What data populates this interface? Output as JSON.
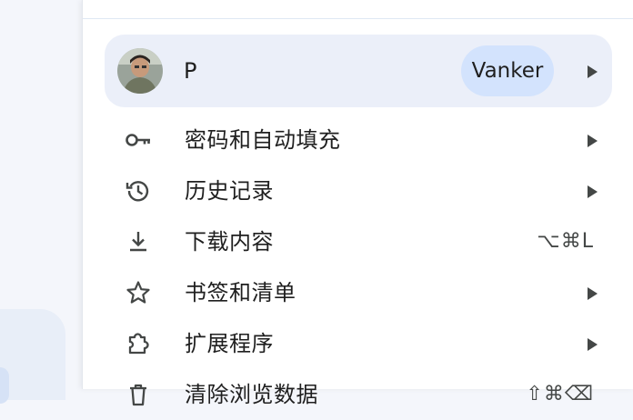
{
  "profile": {
    "name": "P",
    "badge": "Vanker"
  },
  "menu": {
    "items": [
      {
        "label": "密码和自动填充",
        "icon": "key-icon",
        "submenu": true
      },
      {
        "label": "历史记录",
        "icon": "history-icon",
        "submenu": true
      },
      {
        "label": "下载内容",
        "icon": "download-icon",
        "shortcut": "⌥⌘L"
      },
      {
        "label": "书签和清单",
        "icon": "star-icon",
        "submenu": true
      },
      {
        "label": "扩展程序",
        "icon": "extension-icon",
        "submenu": true
      },
      {
        "label": "清除浏览数据",
        "icon": "delete-icon",
        "shortcut": "⇧⌘⌫"
      }
    ]
  },
  "colors": {
    "profile_bg": "#ebeff9",
    "badge_bg": "#d3e3fd",
    "icon": "#444746",
    "text": "#1f1f1f"
  }
}
